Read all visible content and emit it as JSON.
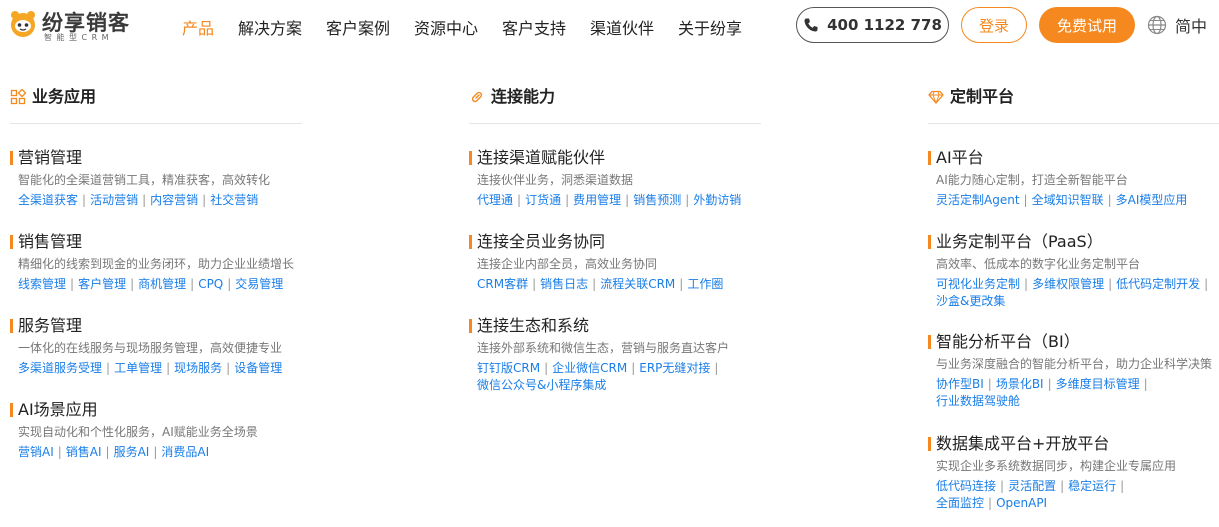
{
  "header": {
    "logo_text": "纷享销客",
    "logo_sub": "智能型CRM",
    "nav": [
      {
        "label": "产品",
        "active": true
      },
      {
        "label": "解决方案",
        "active": false
      },
      {
        "label": "客户案例",
        "active": false
      },
      {
        "label": "资源中心",
        "active": false
      },
      {
        "label": "客户支持",
        "active": false
      },
      {
        "label": "渠道伙伴",
        "active": false
      },
      {
        "label": "关于纷享",
        "active": false
      }
    ],
    "phone": "400 1122 778",
    "login": "登录",
    "trial": "免费试用",
    "lang": "简中"
  },
  "colors": {
    "accent": "#f5891f",
    "link": "#1a7ee8"
  },
  "columns": [
    {
      "title": "业务应用",
      "icon": "grid-icon",
      "items": [
        {
          "title": "营销管理",
          "desc": "智能化的全渠道营销工具，精准获客，高效转化",
          "links": [
            "全渠道获客",
            "活动营销",
            "内容营销",
            "社交营销"
          ]
        },
        {
          "title": "销售管理",
          "desc": "精细化的线索到现金的业务闭环，助力企业业绩增长",
          "links": [
            "线索管理",
            "客户管理",
            "商机管理",
            "CPQ",
            "交易管理"
          ]
        },
        {
          "title": "服务管理",
          "desc": "一体化的在线服务与现场服务管理，高效便捷专业",
          "links": [
            "多渠道服务受理",
            "工单管理",
            "现场服务",
            "设备管理"
          ]
        },
        {
          "title": "AI场景应用",
          "desc": "实现自动化和个性化服务，AI赋能业务全场景",
          "links": [
            "营销AI",
            "销售AI",
            "服务AI",
            "消费品AI"
          ]
        }
      ]
    },
    {
      "title": "连接能力",
      "icon": "link-icon",
      "items": [
        {
          "title": "连接渠道赋能伙伴",
          "desc": "连接伙伴业务，洞悉渠道数据",
          "links": [
            "代理通",
            "订货通",
            "费用管理",
            "销售预测",
            "外勤访销"
          ]
        },
        {
          "title": "连接全员业务协同",
          "desc": "连接企业内部全员，高效业务协同",
          "links": [
            "CRM客群",
            "销售日志",
            "流程关联CRM",
            "工作圈"
          ]
        },
        {
          "title": "连接生态和系统",
          "desc": "连接外部系统和微信生态，营销与服务直达客户",
          "links": [
            "钉钉版CRM",
            "企业微信CRM",
            "ERP无缝对接",
            "微信公众号&小程序集成"
          ]
        }
      ]
    },
    {
      "title": "定制平台",
      "icon": "diamond-icon",
      "items": [
        {
          "title": "AI平台",
          "desc": "AI能力随心定制，打造全新智能平台",
          "links": [
            "灵活定制Agent",
            "全域知识智联",
            "多AI模型应用"
          ]
        },
        {
          "title": "业务定制平台（PaaS）",
          "desc": "高效率、低成本的数字化业务定制平台",
          "links": [
            "可视化业务定制",
            "多维权限管理",
            "低代码定制开发",
            "沙盒&更改集"
          ]
        },
        {
          "title": "智能分析平台（BI）",
          "desc": "与业务深度融合的智能分析平台，助力企业科学决策",
          "links": [
            "协作型BI",
            "场景化BI",
            "多维度目标管理",
            "行业数据驾驶舱"
          ]
        },
        {
          "title": "数据集成平台+开放平台",
          "desc": "实现企业多系统数据同步，构建企业专属应用",
          "links": [
            "低代码连接",
            "灵活配置",
            "稳定运行",
            "全面监控",
            "OpenAPI"
          ]
        }
      ]
    }
  ]
}
